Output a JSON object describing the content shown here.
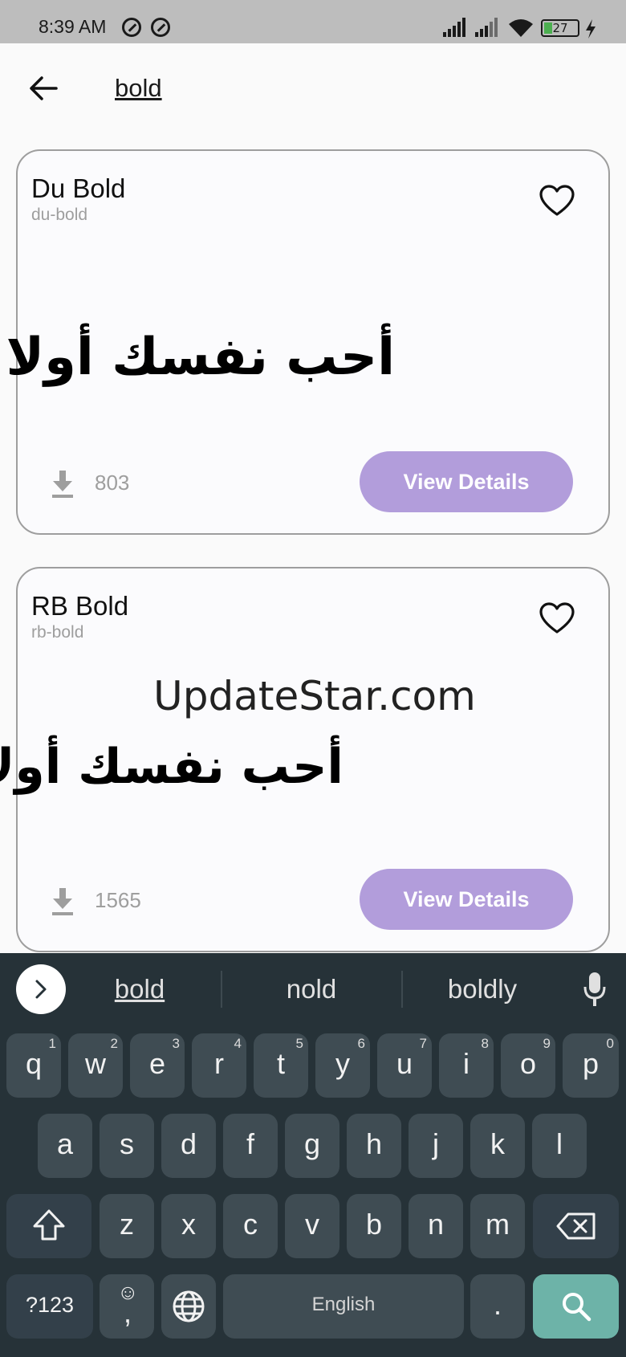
{
  "status_bar": {
    "time": "8:39 AM",
    "battery": "27",
    "icons": [
      "do-not-disturb-icon",
      "data-saver-icon",
      "signal-icon",
      "signal-icon",
      "wifi-icon",
      "battery-icon",
      "charging-icon"
    ]
  },
  "header": {
    "query": "bold",
    "back_icon": "arrow-back-icon"
  },
  "fonts": [
    {
      "title": "Du Bold",
      "slug": "du-bold",
      "preview": "أحب نفسك أولا",
      "downloads": "803",
      "button": "View Details"
    },
    {
      "title": "RB Bold",
      "slug": "rb-bold",
      "preview": "أحب نفسك أولا",
      "downloads": "1565",
      "button": "View Details"
    }
  ],
  "watermark": "UpdateStar.com",
  "keyboard": {
    "suggestions": [
      "bold",
      "nold",
      "boldly"
    ],
    "row1": [
      {
        "k": "q",
        "n": "1"
      },
      {
        "k": "w",
        "n": "2"
      },
      {
        "k": "e",
        "n": "3"
      },
      {
        "k": "r",
        "n": "4"
      },
      {
        "k": "t",
        "n": "5"
      },
      {
        "k": "y",
        "n": "6"
      },
      {
        "k": "u",
        "n": "7"
      },
      {
        "k": "i",
        "n": "8"
      },
      {
        "k": "o",
        "n": "9"
      },
      {
        "k": "p",
        "n": "0"
      }
    ],
    "row2": [
      "a",
      "s",
      "d",
      "f",
      "g",
      "h",
      "j",
      "k",
      "l"
    ],
    "row3": [
      "z",
      "x",
      "c",
      "v",
      "b",
      "n",
      "m"
    ],
    "symbols_key": "?123",
    "comma_key": ",",
    "space_label": "English",
    "period_key": ".",
    "colors": {
      "accent": "#b29ddb",
      "search_key": "#6db3a8",
      "keyboard_bg": "#263238"
    }
  }
}
